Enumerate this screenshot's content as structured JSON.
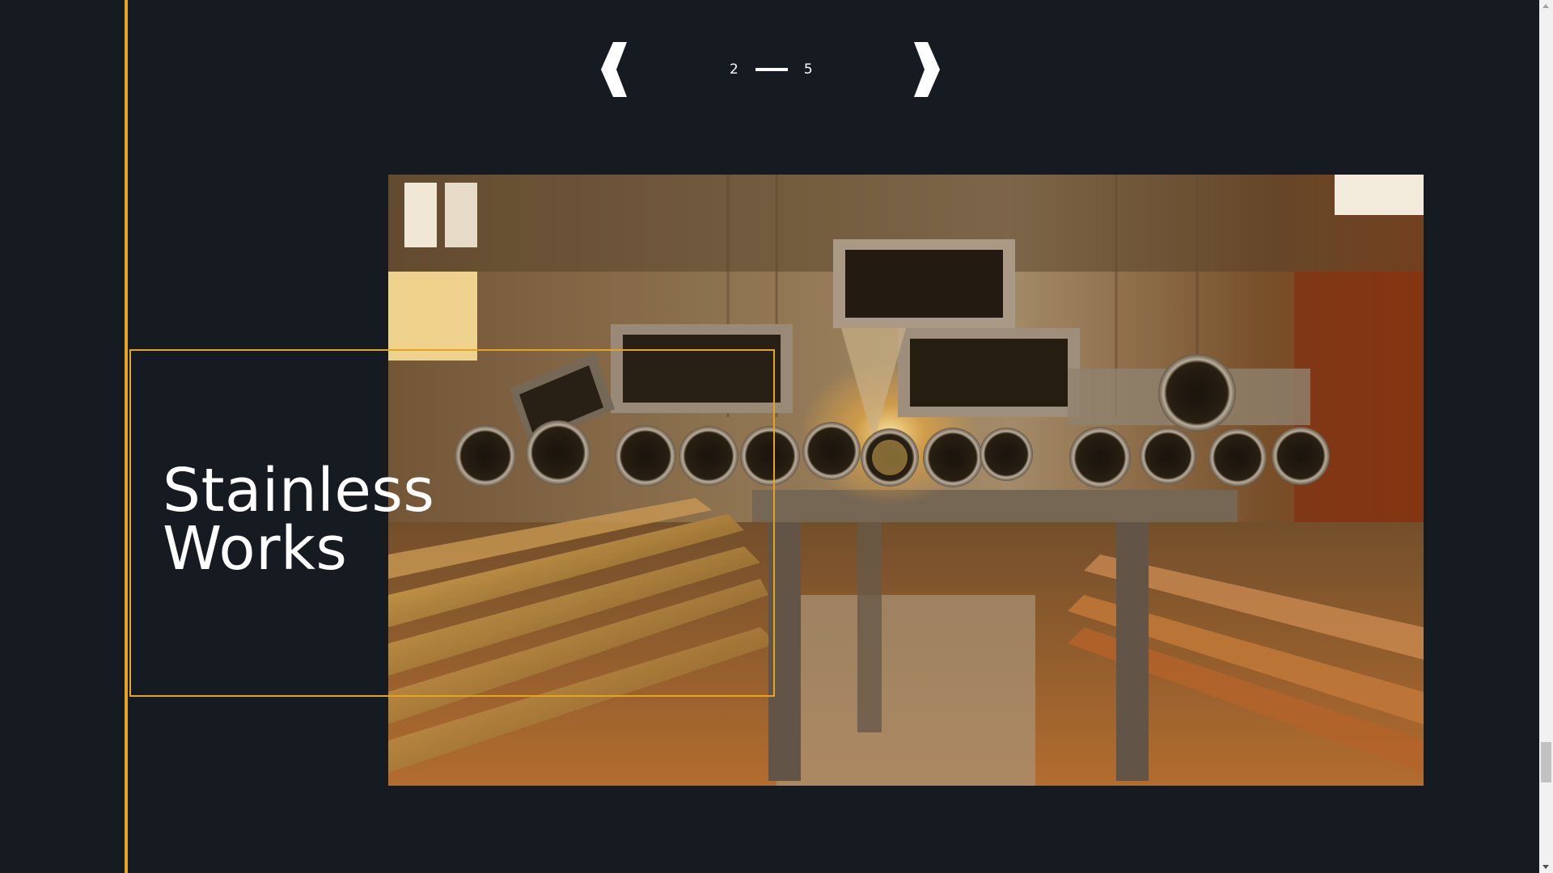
{
  "slider": {
    "current": "2",
    "total": "5",
    "prev_icon": "chevron-left-icon",
    "next_icon": "chevron-right-icon"
  },
  "hero": {
    "title_line1": "Stainless",
    "title_line2": "Works"
  },
  "colors": {
    "background": "#161b22",
    "accent": "#e6a51e",
    "text": "#ffffff"
  }
}
